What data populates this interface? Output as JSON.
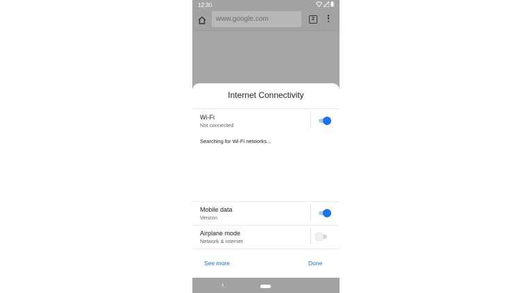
{
  "status_bar": {
    "time": "12:30"
  },
  "browser": {
    "url": "www.google.com",
    "tab_count": "2"
  },
  "dialog": {
    "title": "Internet Connectivity",
    "wifi": {
      "label": "Wi-Fi",
      "status": "Not connected",
      "enabled": true
    },
    "searching_text": "Searching for Wi-Fi networks...",
    "mobile_data": {
      "label": "Mobile data",
      "status": "Verizon",
      "enabled": true
    },
    "airplane_mode": {
      "label": "Airplane mode",
      "status": "Network & internet",
      "enabled": false
    },
    "see_more_label": "See more",
    "done_label": "Done"
  },
  "nav": {
    "back_glyph": "‹"
  },
  "colors": {
    "accent": "#1a73e8",
    "scrim": "#a7a7a7"
  }
}
